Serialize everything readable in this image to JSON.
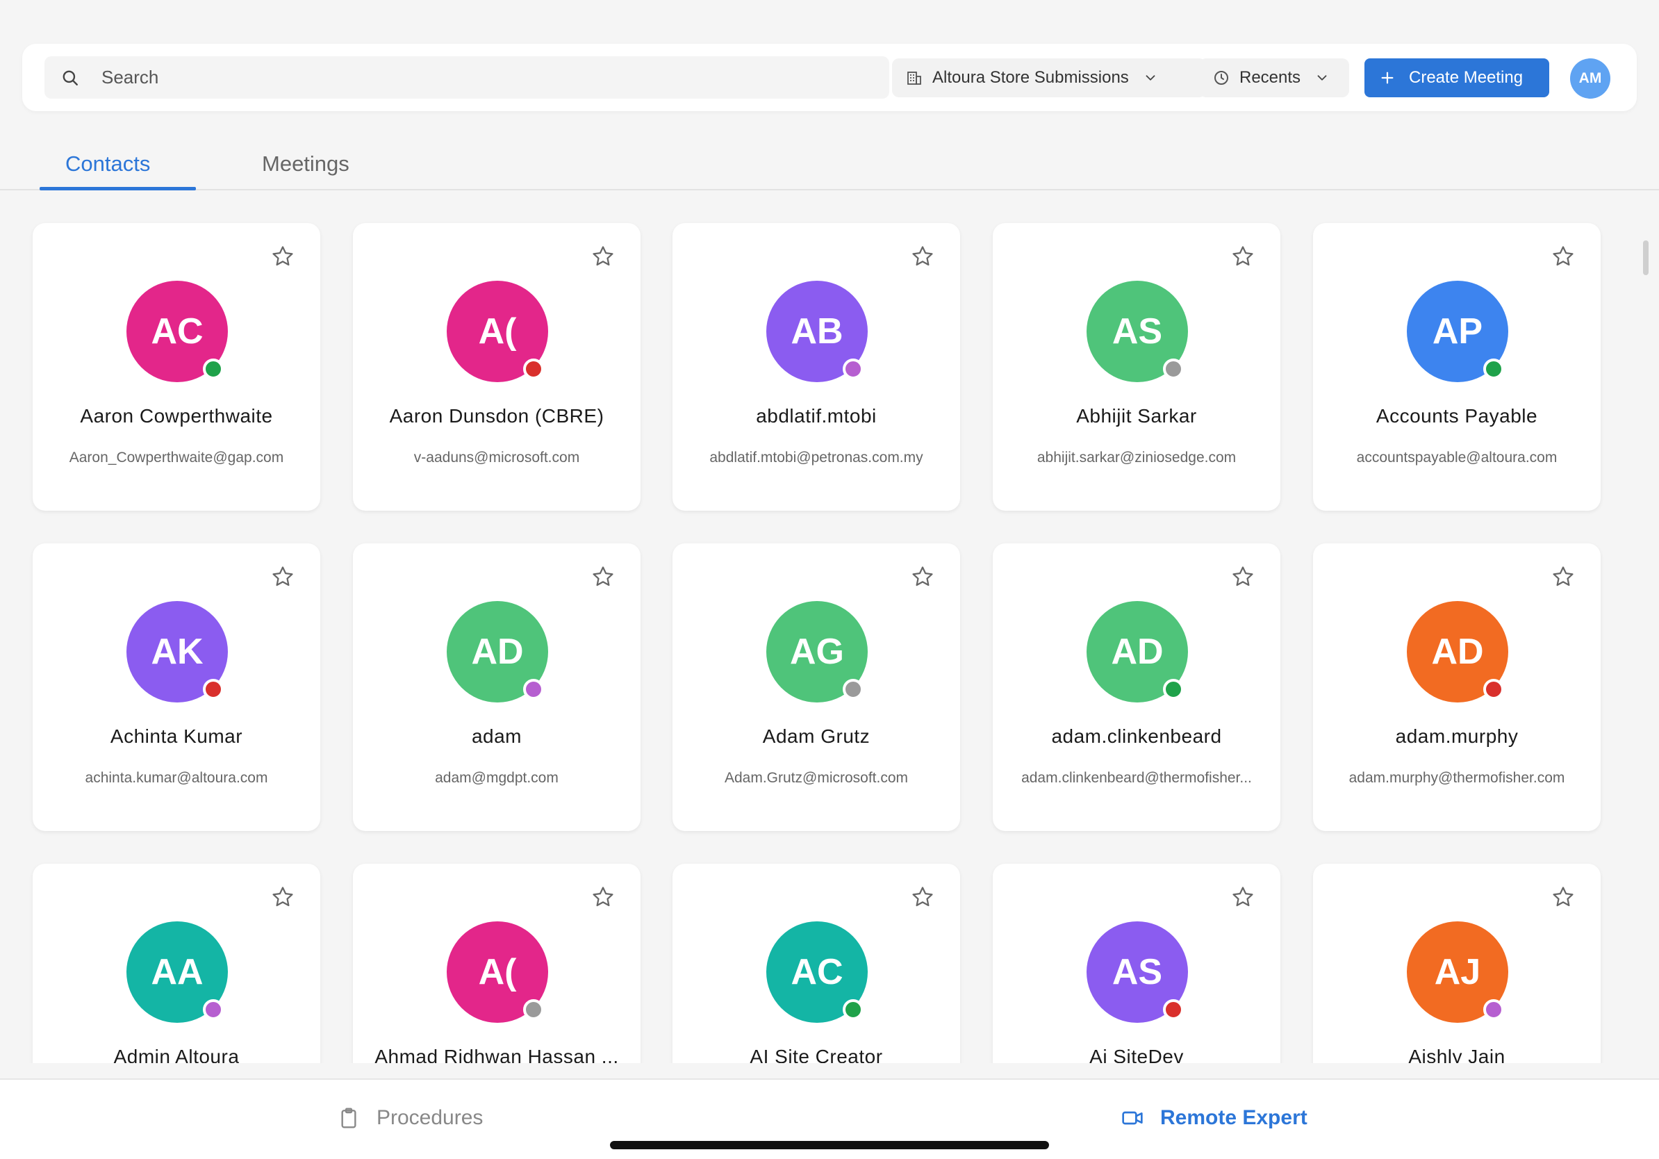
{
  "topbar": {
    "search_placeholder": "Search",
    "store_label": "Altoura Store Submissions",
    "recents_label": "Recents",
    "create_label": "Create Meeting",
    "user_initials": "AM"
  },
  "tabs": {
    "contacts": "Contacts",
    "meetings": "Meetings"
  },
  "contacts": [
    {
      "initials": "AC",
      "name": "Aaron Cowperthwaite",
      "email": "Aaron_Cowperthwaite@gap.com",
      "color": "#e3268a",
      "status": "#1fa24a"
    },
    {
      "initials": "A(",
      "name": "Aaron Dunsdon (CBRE)",
      "email": "v-aaduns@microsoft.com",
      "color": "#e3268a",
      "status": "#d9302c"
    },
    {
      "initials": "AB",
      "name": "abdlatif.mtobi",
      "email": "abdlatif.mtobi@petronas.com.my",
      "color": "#8b5cf0",
      "status": "#b65fd0"
    },
    {
      "initials": "AS",
      "name": "Abhijit Sarkar",
      "email": "abhijit.sarkar@ziniosedge.com",
      "color": "#4fc47a",
      "status": "#9a9a9a"
    },
    {
      "initials": "AP",
      "name": "Accounts Payable",
      "email": "accountspayable@altoura.com",
      "color": "#3d84ef",
      "status": "#1fa24a"
    },
    {
      "initials": "AK",
      "name": "Achinta Kumar",
      "email": "achinta.kumar@altoura.com",
      "color": "#8b5cf0",
      "status": "#d9302c"
    },
    {
      "initials": "AD",
      "name": "adam",
      "email": "adam@mgdpt.com",
      "color": "#4fc47a",
      "status": "#b65fd0"
    },
    {
      "initials": "AG",
      "name": "Adam Grutz",
      "email": "Adam.Grutz@microsoft.com",
      "color": "#4fc47a",
      "status": "#9a9a9a"
    },
    {
      "initials": "AD",
      "name": "adam.clinkenbeard",
      "email": "adam.clinkenbeard@thermofisher...",
      "color": "#4fc47a",
      "status": "#1fa24a"
    },
    {
      "initials": "AD",
      "name": "adam.murphy",
      "email": "adam.murphy@thermofisher.com",
      "color": "#f26b22",
      "status": "#d9302c"
    },
    {
      "initials": "AA",
      "name": "Admin Altoura",
      "email": "",
      "color": "#14b5a5",
      "status": "#b65fd0"
    },
    {
      "initials": "A(",
      "name": "Ahmad Ridhwan Hassan ...",
      "email": "",
      "color": "#e3268a",
      "status": "#9a9a9a"
    },
    {
      "initials": "AC",
      "name": "AI Site Creator",
      "email": "",
      "color": "#14b5a5",
      "status": "#1fa24a"
    },
    {
      "initials": "AS",
      "name": "Ai SiteDev",
      "email": "",
      "color": "#8b5cf0",
      "status": "#d9302c"
    },
    {
      "initials": "AJ",
      "name": "Aishly Jain",
      "email": "",
      "color": "#f26b22",
      "status": "#b65fd0"
    }
  ],
  "bottomnav": {
    "procedures": "Procedures",
    "remote_expert": "Remote Expert"
  }
}
